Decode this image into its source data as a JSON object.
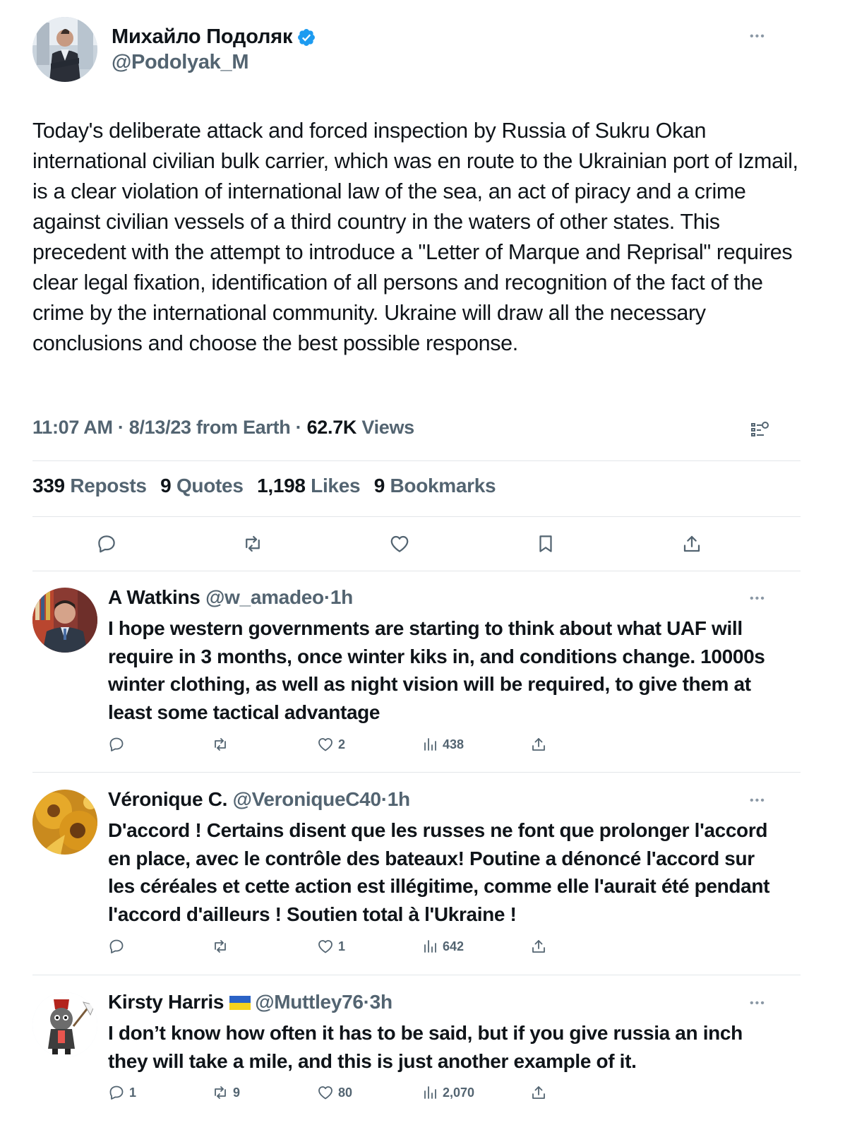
{
  "main_tweet": {
    "author_name": "Михайло Подоляк",
    "author_handle": "@Podolyak_M",
    "text": "Today's deliberate attack and forced inspection by Russia of Sukru Okan international civilian bulk carrier, which was en route to the Ukrainian port of Izmail, is a clear violation of international law of the sea, an act of piracy and a crime against civilian vessels of a third country in the waters of other states. This precedent with the attempt to introduce a \"Letter of Marque and Reprisal\" requires clear legal fixation, identification of all persons and recognition of the fact of the crime by the international community. Ukraine will draw all the necessary conclusions and choose the best possible response.",
    "time": "11:07 AM",
    "date": "8/13/23 from Earth",
    "separator": "·",
    "views_count": "62.7K",
    "views_label": "Views",
    "stats": {
      "reposts_count": "339",
      "reposts_label": "Reposts",
      "quotes_count": "9",
      "quotes_label": "Quotes",
      "likes_count": "1,198",
      "likes_label": "Likes",
      "bookmarks_count": "9",
      "bookmarks_label": "Bookmarks"
    },
    "actions": [
      "reply-icon",
      "repost-icon",
      "like-icon",
      "bookmark-icon",
      "share-icon"
    ]
  },
  "replies": [
    {
      "name": "A Watkins",
      "handle": "@w_amadeo",
      "separator": "·",
      "time": "1h",
      "text": "I hope western governments are starting to think about what UAF will require in 3 months, once winter kiks in, and conditions change. 10000s winter clothing, as well as night vision will be required, to give them at least some tactical advantage",
      "replies_count": "",
      "reposts_count": "",
      "likes_count": "2",
      "views_count": "438"
    },
    {
      "name": "Véronique C.",
      "handle": "@VeroniqueC40",
      "separator": "·",
      "time": "1h",
      "text": "D'accord ! Certains disent que les russes ne font que prolonger l'accord en place, avec le contrôle des bateaux! Poutine a dénoncé l'accord sur les céréales et cette action est illégitime, comme elle l'aurait été pendant l'accord d'ailleurs ! Soutien total à l'Ukraine !",
      "replies_count": "",
      "reposts_count": "",
      "likes_count": "1",
      "views_count": "642"
    },
    {
      "name": "Kirsty Harris",
      "handle": "@Muttley76",
      "separator": "·",
      "time": "3h",
      "text": "I don’t know how often it has to be said, but if you give russia an inch they will take a mile, and this is just another example of it.",
      "replies_count": "1",
      "reposts_count": "9",
      "likes_count": "80",
      "views_count": "2,070"
    }
  ],
  "colors": {
    "text": "#0f1419",
    "secondary": "#536471",
    "verified": "#1d9bf0",
    "divider": "#e3e6e9"
  }
}
